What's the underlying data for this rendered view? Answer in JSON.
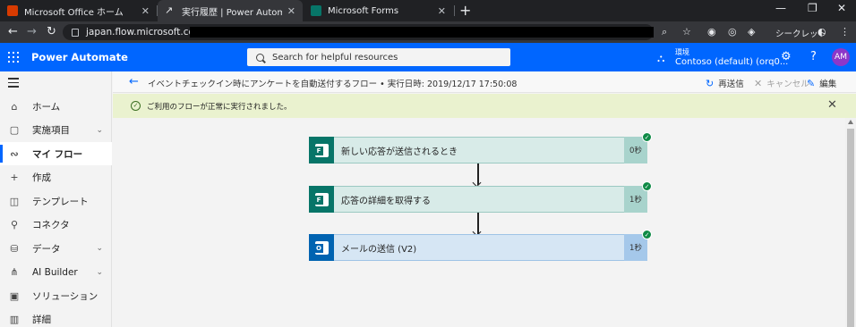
{
  "browser": {
    "tabs": [
      {
        "title": "Microsoft Office ホーム",
        "color": "#d83b01"
      },
      {
        "title": "実行履歴 | Power Automate",
        "color": "#0066ff"
      },
      {
        "title": "Microsoft Forms",
        "color": "#077568"
      }
    ],
    "url": "japan.flow.microsoft.com/",
    "incognito_label": "シークレット"
  },
  "header": {
    "app_name": "Power Automate",
    "search_placeholder": "Search for helpful resources",
    "environment_label": "環境",
    "environment_name": "Contoso (default) (orq0...",
    "avatar_initials": "AM"
  },
  "sidebar": {
    "items": [
      {
        "label": "ホーム",
        "icon": "home-icon",
        "glyph": "⌂",
        "active": false,
        "chevron": false
      },
      {
        "label": "実施項目",
        "icon": "clipboard-icon",
        "glyph": "▢",
        "active": false,
        "chevron": true
      },
      {
        "label": "マイ フロー",
        "icon": "flow-icon",
        "glyph": "∾",
        "active": true,
        "chevron": false
      },
      {
        "label": "作成",
        "icon": "plus-icon",
        "glyph": "+",
        "active": false,
        "chevron": false
      },
      {
        "label": "テンプレート",
        "icon": "template-icon",
        "glyph": "◫",
        "active": false,
        "chevron": false
      },
      {
        "label": "コネクタ",
        "icon": "connector-icon",
        "glyph": "⚲",
        "active": false,
        "chevron": false
      },
      {
        "label": "データ",
        "icon": "database-icon",
        "glyph": "⛁",
        "active": false,
        "chevron": true
      },
      {
        "label": "AI Builder",
        "icon": "ai-builder-icon",
        "glyph": "⋔",
        "active": false,
        "chevron": true
      },
      {
        "label": "ソリューション",
        "icon": "solution-icon",
        "glyph": "▣",
        "active": false,
        "chevron": false
      },
      {
        "label": "詳細",
        "icon": "book-icon",
        "glyph": "▥",
        "active": false,
        "chevron": false
      }
    ]
  },
  "command_bar": {
    "breadcrumb": "イベントチェックイン時にアンケートを自動送付するフロー • 実行日時: 2019/12/17 17:50:08",
    "resubmit": "再送信",
    "cancel": "キャンセル",
    "edit": "編集"
  },
  "banner": {
    "message": "ご利用のフローが正常に実行されました。"
  },
  "flow_steps": [
    {
      "label": "新しい応答が送信されるとき",
      "duration": "0秒",
      "connector": "Microsoft Forms",
      "icon_letter": "F"
    },
    {
      "label": "応答の詳細を取得する",
      "duration": "1秒",
      "connector": "Microsoft Forms",
      "icon_letter": "F"
    },
    {
      "label": "メールの送信 (V2)",
      "duration": "1秒",
      "connector": "Office 365 Outlook",
      "icon_letter": "O"
    }
  ]
}
